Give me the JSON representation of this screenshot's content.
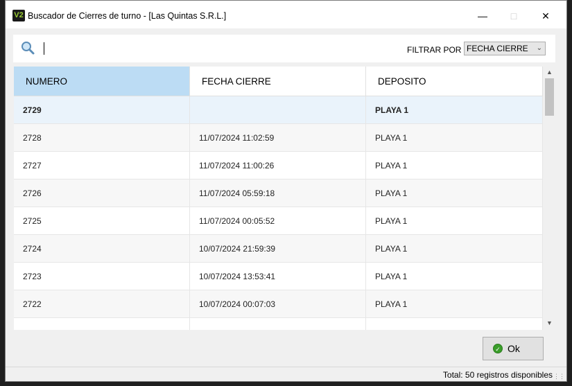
{
  "window": {
    "title": "Buscador de Cierres de turno - [Las Quintas S.R.L.]",
    "app_icon_text": "V2",
    "minimize_icon": "minimize-icon",
    "maximize_icon": "maximize-icon",
    "close_icon": "close-icon"
  },
  "search": {
    "value": "",
    "icon": "magnifier-icon",
    "filter_label": "FILTRAR POR",
    "filter_selected": "FECHA CIERRE"
  },
  "table": {
    "columns": [
      "NUMERO",
      "FECHA CIERRE",
      "DEPOSITO"
    ],
    "sorted_column_color": "#bcdcf4",
    "selected_row_color": "#eaf3fb",
    "rows": [
      {
        "numero": "2729",
        "fecha": "",
        "deposito": "PLAYA 1"
      },
      {
        "numero": "2728",
        "fecha": "11/07/2024 11:02:59",
        "deposito": "PLAYA 1"
      },
      {
        "numero": "2727",
        "fecha": "11/07/2024 11:00:26",
        "deposito": "PLAYA 1"
      },
      {
        "numero": "2726",
        "fecha": "11/07/2024 05:59:18",
        "deposito": "PLAYA 1"
      },
      {
        "numero": "2725",
        "fecha": "11/07/2024 00:05:52",
        "deposito": "PLAYA 1"
      },
      {
        "numero": "2724",
        "fecha": "10/07/2024 21:59:39",
        "deposito": "PLAYA 1"
      },
      {
        "numero": "2723",
        "fecha": "10/07/2024 13:53:41",
        "deposito": "PLAYA 1"
      },
      {
        "numero": "2722",
        "fecha": "10/07/2024 00:07:03",
        "deposito": "PLAYA 1"
      }
    ]
  },
  "buttons": {
    "ok_label": "Ok",
    "ok_icon": "check-circle-icon"
  },
  "status": {
    "text": "Total: 50 registros disponibles"
  }
}
